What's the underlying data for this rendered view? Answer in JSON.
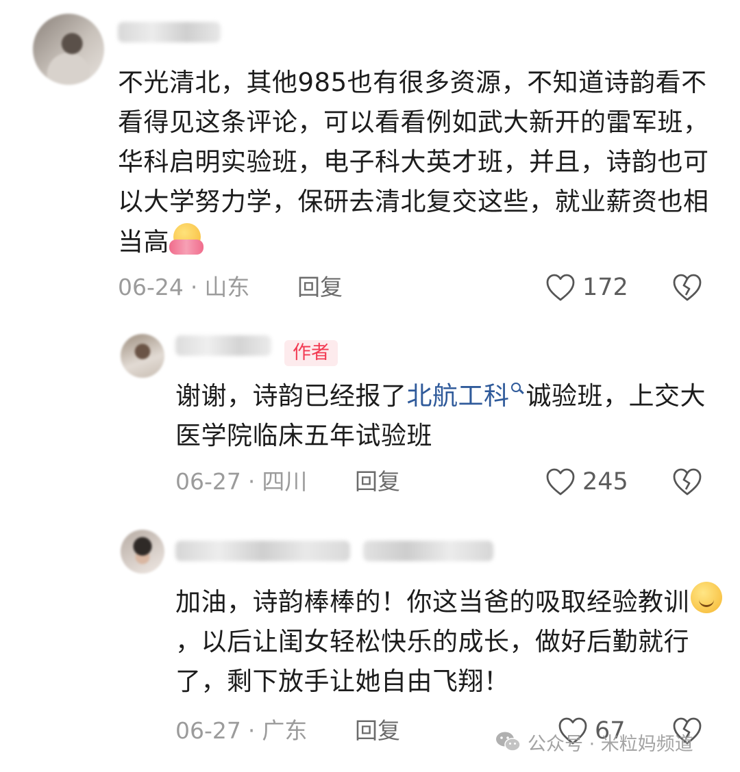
{
  "comments": [
    {
      "text": "不光清北，其他985也有很多资源，不知道诗韵看不看得见这条评论，可以看看例如武大新开的雷军班，华科启明实验班，电子科大英才班，并且，诗韵也可以大学努力学，保研去清北复交这些，就业薪资也相当高",
      "emoji": "hugging-face-emoji",
      "date": "06-24",
      "location": "山东",
      "reply_label": "回复",
      "likes": "172"
    },
    {
      "author_badge": "作者",
      "text_before": "谢谢，诗韵已经报了",
      "link_text": "北航工科",
      "text_after": "诚验班，上交大医学院临床五年试验班",
      "date": "06-27",
      "location": "四川",
      "reply_label": "回复",
      "likes": "245"
    },
    {
      "text_before": "加油，诗韵棒棒的！你这当爸的吸取经验教训",
      "emoji": "smiling-face-emoji",
      "text_after": "，以后让闺女轻松快乐的成长，做好后勤就行了，剩下放手让她自由飞翔！",
      "date": "06-27",
      "location": "广东",
      "reply_label": "回复",
      "likes": "67"
    }
  ],
  "separator": "·",
  "watermark": {
    "icon": "wechat-icon",
    "text": "公众号 · 米粒妈频道"
  },
  "colors": {
    "badge_text": "#f23a52",
    "badge_bg": "#fdebed",
    "link": "#2f5a9a",
    "meta": "#9b9b9b"
  }
}
